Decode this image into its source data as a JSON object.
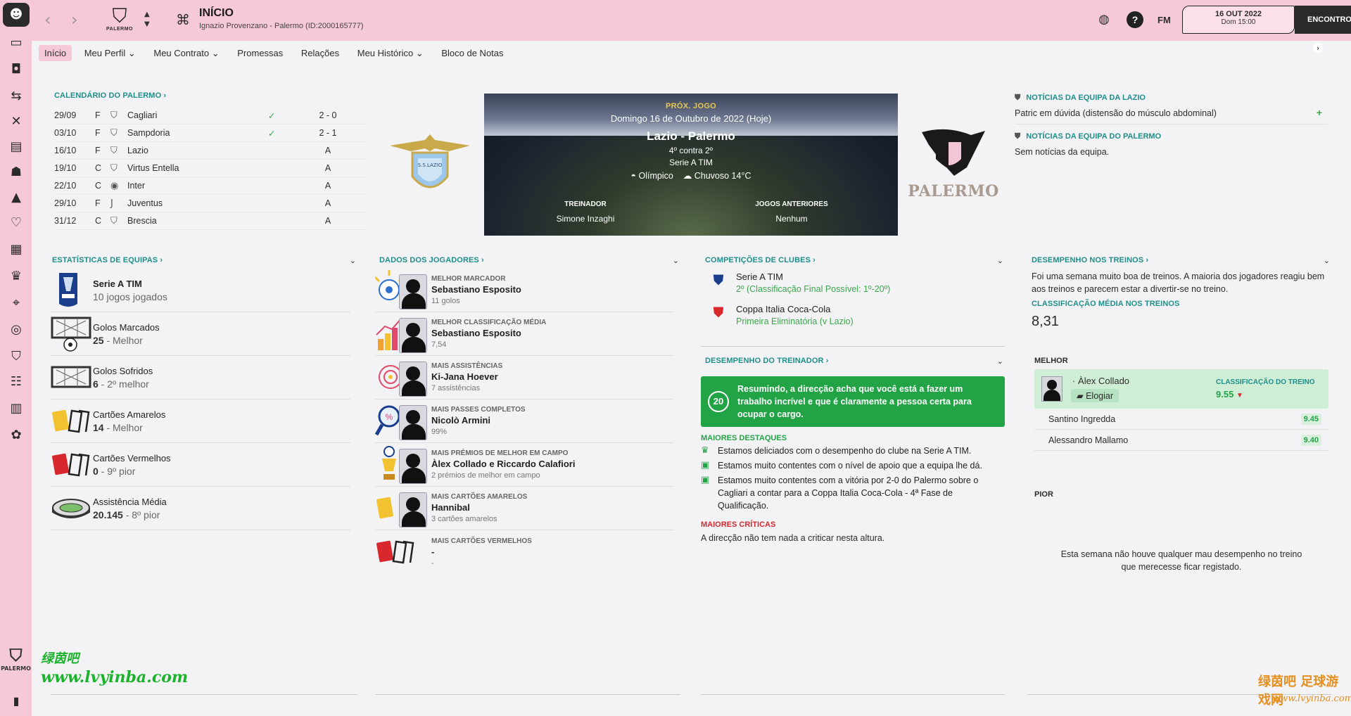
{
  "sidebar": {
    "icons": [
      "avatar-icon",
      "inbox-icon",
      "squad-icon",
      "transfers-icon",
      "tactics-icon",
      "scouting-icon",
      "staff-icon",
      "training-icon",
      "medical-icon",
      "schedule-icon",
      "competitions-icon",
      "scouting-binoculars-icon",
      "world-icon",
      "club-icon",
      "dynamics-icon",
      "finances-icon",
      "development-icon",
      "battery-icon"
    ],
    "club_short": "PALERMO"
  },
  "header": {
    "title": "INÍCIO",
    "subtitle": "Ignazio Provenzano - Palermo (ID:2000165777)",
    "club_logo_text": "PALERMO",
    "fm_label": "FM",
    "date": "16 OUT 2022",
    "day_time": "Dom 15:00",
    "continue_label": "ENCONTROS"
  },
  "tabs": [
    {
      "label": "Início"
    },
    {
      "label": "Meu Perfil ⌄"
    },
    {
      "label": "Meu Contrato ⌄"
    },
    {
      "label": "Promessas"
    },
    {
      "label": "Relações"
    },
    {
      "label": "Meu Histórico ⌄"
    },
    {
      "label": "Bloco de Notas"
    }
  ],
  "calendar": {
    "heading": "CALENDÁRIO DO PALERMO ›",
    "rows": [
      {
        "date": "29/09",
        "venue": "F",
        "opponent": "Cagliari",
        "check": "✓",
        "result": "2 - 0"
      },
      {
        "date": "03/10",
        "venue": "F",
        "opponent": "Sampdoria",
        "check": "✓",
        "result": "2 - 1"
      },
      {
        "date": "16/10",
        "venue": "F",
        "opponent": "Lazio",
        "check": "",
        "result": "A"
      },
      {
        "date": "19/10",
        "venue": "C",
        "opponent": "Virtus Entella",
        "check": "",
        "result": "A"
      },
      {
        "date": "22/10",
        "venue": "C",
        "opponent": "Inter",
        "check": "",
        "result": "A"
      },
      {
        "date": "29/10",
        "venue": "F",
        "opponent": "Juventus",
        "check": "",
        "result": "A"
      },
      {
        "date": "31/12",
        "venue": "C",
        "opponent": "Brescia",
        "check": "",
        "result": "A"
      }
    ]
  },
  "next_match": {
    "label": "PRÓX. JOGO",
    "date": "Domingo 16 de Outubro de 2022 (Hoje)",
    "fixture": "Lazio - Palermo",
    "positions": "4º contra 2º",
    "competition": "Serie A TIM",
    "stadium": "Olímpico",
    "weather": "Chuvoso 14°C",
    "coach_label": "TREINADOR",
    "coach_value": "Simone Inzaghi",
    "prev_label": "JOGOS ANTERIORES",
    "prev_value": "Nenhum",
    "home_crest_text": "S.S.LAZIO",
    "away_crest_text": "PALERMO"
  },
  "news": {
    "lazio_heading": "NOTÍCIAS DA EQUIPA DA LAZIO",
    "lazio_item": "Patric em dúvida (distensão do músculo abdominal)",
    "palermo_heading": "NOTÍCIAS DA EQUIPA DO PALERMO",
    "palermo_item": "Sem notícias da equipa."
  },
  "team_stats": {
    "heading": "ESTATÍSTICAS DE EQUIPAS ›",
    "rows": [
      {
        "title": "Serie A TIM",
        "value_main": "",
        "value_rest": "10 jogos jogados",
        "bold_title": true
      },
      {
        "title": "Golos Marcados",
        "value_main": "25",
        "value_rest": " - Melhor"
      },
      {
        "title": "Golos Sofridos",
        "value_main": "6",
        "value_rest": " - 2º melhor"
      },
      {
        "title": "Cartões Amarelos",
        "value_main": "14",
        "value_rest": " - Melhor"
      },
      {
        "title": "Cartões Vermelhos",
        "value_main": "0",
        "value_rest": " - 9º pior"
      },
      {
        "title": "Assistência Média",
        "value_main": "20.145",
        "value_rest": " - 8º pior"
      }
    ]
  },
  "player_data": {
    "heading": "DADOS DOS JOGADORES ›",
    "rows": [
      {
        "label": "MELHOR MARCADOR",
        "name": "Sebastiano Esposito",
        "sub": "11 golos"
      },
      {
        "label": "MELHOR CLASSIFICAÇÃO MÉDIA",
        "name": "Sebastiano Esposito",
        "sub": "7,54"
      },
      {
        "label": "MAIS ASSISTÊNCIAS",
        "name": "Ki-Jana Hoever",
        "sub": "7 assistências"
      },
      {
        "label": "MAIS PASSES COMPLETOS",
        "name": "Nicolò Armini",
        "sub": "99%"
      },
      {
        "label": "MAIS PRÉMIOS DE MELHOR EM CAMPO",
        "name": "Àlex Collado e Riccardo Calafiori",
        "sub": "2 prémios de melhor em campo"
      },
      {
        "label": "MAIS CARTÕES AMARELOS",
        "name": "Hannibal",
        "sub": "3 cartões amarelos"
      },
      {
        "label": "MAIS CARTÕES VERMELHOS",
        "name": "-",
        "sub": "-"
      }
    ]
  },
  "club_comps": {
    "heading": "COMPETIÇÕES DE CLUBES ›",
    "rows": [
      {
        "name": "Serie A TIM",
        "status": "2º (Classificação Final Possível: 1º-20º)"
      },
      {
        "name": "Coppa Italia Coca-Cola",
        "status": "Primeira Eliminatória (v Lazio)"
      }
    ]
  },
  "coach_perf": {
    "heading": "DESEMPENHO DO TREINADOR ›",
    "score": "20",
    "summary": "Resumindo, a direcção acha que você está a fazer um trabalho incrível e que é claramente a pessoa certa para ocupar o cargo.",
    "highlights_heading": "MAIORES DESTAQUES",
    "highlights": [
      "Estamos deliciados com o desempenho do clube na Serie A TIM.",
      "Estamos muito contentes com o nível de apoio que a equipa lhe dá.",
      "Estamos muito contentes com a vitória por 2-0 do Palermo sobre o Cagliari a contar para a Coppa Italia Coca-Cola - 4ª Fase de Qualificação."
    ],
    "criticism_heading": "MAIORES CRÍTICAS",
    "criticism": "A direcção não tem nada a criticar nesta altura."
  },
  "training": {
    "heading": "DESEMPENHO NOS TREINOS ›",
    "text": "Foi uma semana muito boa de treinos. A maioria dos jogadores reagiu bem aos treinos e parecem estar a divertir-se no treino.",
    "avg_label": "CLASSIFICAÇÃO MÉDIA NOS TREINOS",
    "avg_value": "8,31",
    "best_label": "MELHOR",
    "best_player": "Àlex Collado",
    "praise_label": "Elogiar",
    "best_score_label": "CLASSIFICAÇÃO DO TREINO",
    "best_score": "9.55",
    "others": [
      {
        "name": "Santino Ingredda",
        "score": "9.45"
      },
      {
        "name": "Alessandro Mallamo",
        "score": "9.40"
      }
    ],
    "worst_label": "PIOR",
    "worst_text": "Esta semana não houve qualquer mau desempenho no treino que merecesse ficar registado."
  },
  "watermarks": {
    "left_cn": "绿茵吧",
    "left_url": "www.lvyinba.com",
    "right_cn": "绿茵吧 足球游戏网",
    "right_url": "www.lvyinba.com"
  },
  "colors": {
    "accent": "#1e8f8a",
    "topbar": "#f6c9d8",
    "positive": "#22a345"
  }
}
